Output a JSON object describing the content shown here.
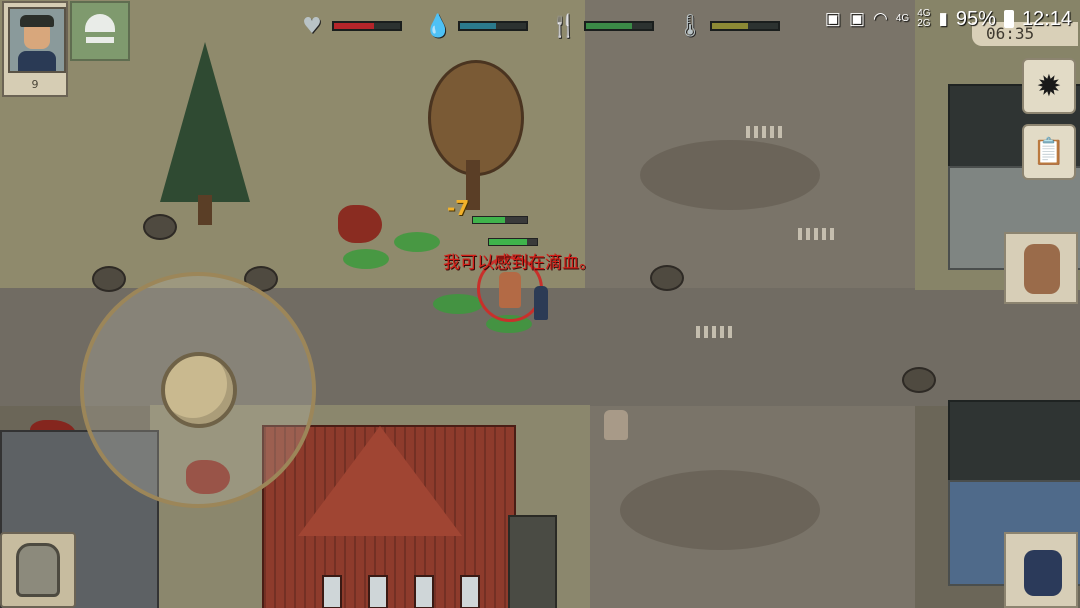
{
  "hud": {
    "player_level": "9",
    "floating_damage": "-7",
    "speech_text": "我可以感到在滴血。",
    "stats": [
      {
        "icon": "heart-icon",
        "glyph": "♥",
        "fill": 0.6,
        "color": "#b5252a"
      },
      {
        "icon": "water-drop-icon",
        "glyph": "💧",
        "fill": 0.55,
        "color": "#2b7a8c"
      },
      {
        "icon": "fork-knife-icon",
        "glyph": "🍴",
        "fill": 0.7,
        "color": "#3b8a47"
      },
      {
        "icon": "thermometer-icon",
        "glyph": "🌡",
        "fill": 0.55,
        "color": "#8c8a35"
      }
    ],
    "clock_partial": "06:35"
  },
  "status_bar": {
    "network_top": "4G",
    "network_bottom": "4G\n2G",
    "battery": "95%",
    "time": "12:14"
  },
  "side_buttons": [
    {
      "name": "settings-gear-button",
      "glyph": "✹"
    },
    {
      "name": "journal-button",
      "glyph": "📋"
    }
  ],
  "colors": {
    "grass": "#8f8a6c",
    "road": "#716c63",
    "blood": "#8a1b14",
    "target_ring": "#c8302b"
  }
}
